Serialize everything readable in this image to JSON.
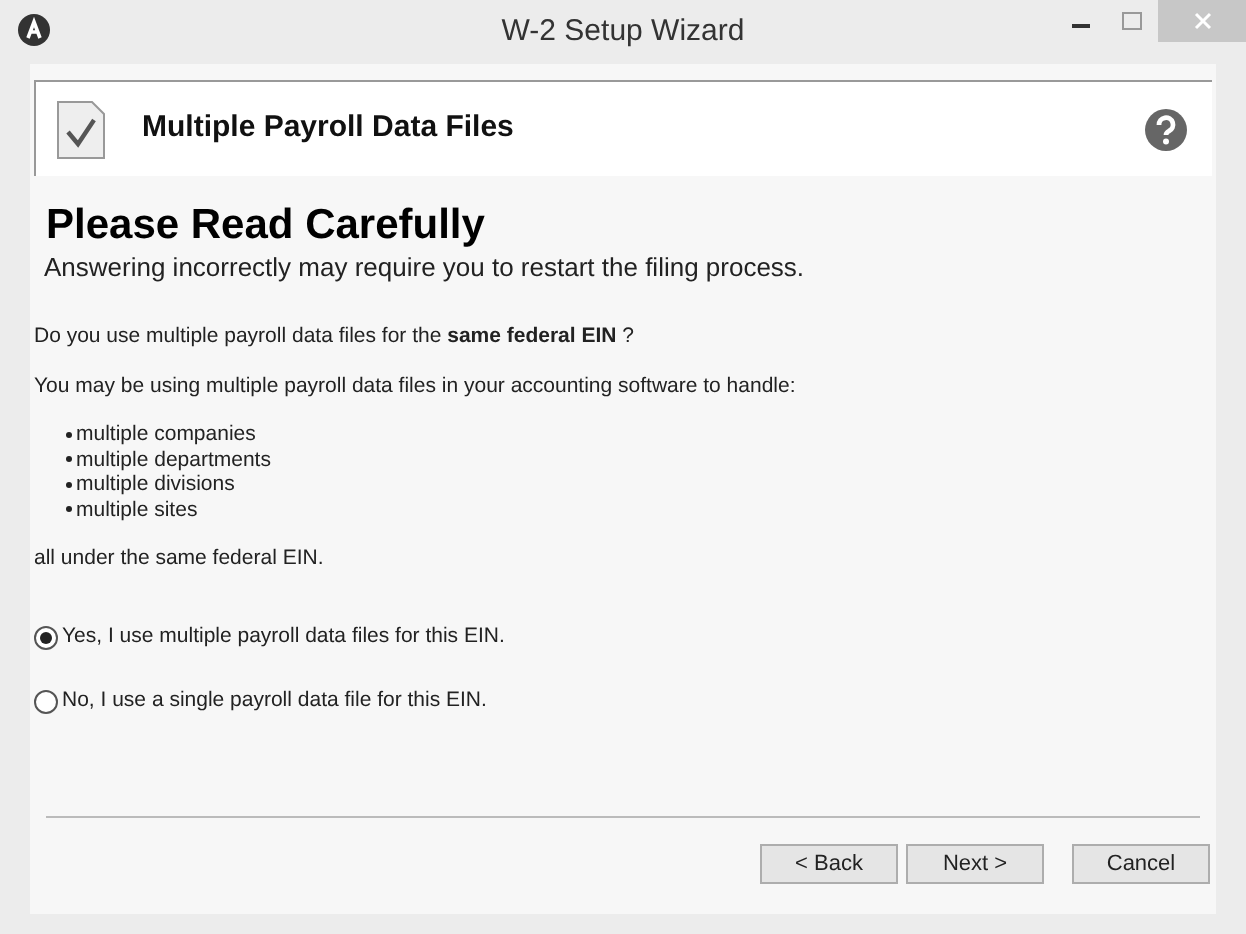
{
  "window": {
    "title": "W-2 Setup Wizard"
  },
  "header": {
    "title": "Multiple Payroll Data Files"
  },
  "heading": "Please Read Carefully",
  "subheading": "Answering incorrectly may require you to restart the filing process.",
  "question": "Do you use multiple payroll data files for the **same federal EIN** ?",
  "intro": "You may be using multiple payroll data files in your accounting software to handle:",
  "items": [
    "multiple companies",
    "multiple departments",
    "multiple divisions",
    "multiple sites"
  ],
  "closing": "all under the same federal EIN.",
  "options": [
    {
      "label": "Yes, I use multiple payroll data files for this EIN.",
      "selected": true
    },
    {
      "label": "No, I use a single payroll data file for this EIN.",
      "selected": false
    }
  ],
  "buttons": [
    "< Back",
    "Next >",
    "Cancel"
  ]
}
